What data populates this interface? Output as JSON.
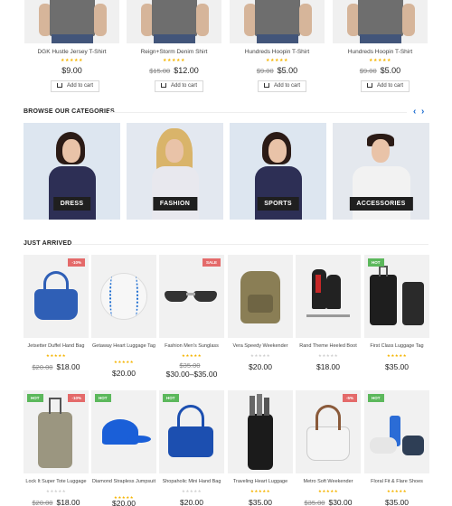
{
  "colors": {
    "accent": "#1a6bd0",
    "star": "#f5b400",
    "sale_badge": "#e46a6a",
    "hot_badge": "#5cb85c",
    "label_bg": "#1f1f1f"
  },
  "top_products": [
    {
      "name": "DGK Hustle Jersey T-Shirt",
      "old_price": "",
      "price": "$9.00",
      "stars": "★★★★★",
      "cart": "Add to cart"
    },
    {
      "name": "Reign+Storm Denim Shirt",
      "old_price": "$15.00",
      "price": "$12.00",
      "stars": "★★★★★",
      "cart": "Add to cart"
    },
    {
      "name": "Hundreds Hoopin T-Shirt",
      "old_price": "$9.00",
      "price": "$5.00",
      "stars": "★★★★★",
      "cart": "Add to cart"
    },
    {
      "name": "Hundreds Hoopin T-Shirt",
      "old_price": "$9.00",
      "price": "$5.00",
      "stars": "★★★★★",
      "cart": "Add to cart"
    }
  ],
  "categories_section": {
    "title": "BROWSE OUR CATEGORIES",
    "prev_icon": "chevron-left-icon",
    "next_icon": "chevron-right-icon",
    "items": [
      {
        "label": "DRESS"
      },
      {
        "label": "FASHION"
      },
      {
        "label": "SPORTS"
      },
      {
        "label": "ACCESSORIES"
      }
    ]
  },
  "just_arrived": {
    "title": "JUST ARRIVED",
    "row1": [
      {
        "name": "Jetsetter Duffel Hand Bag",
        "old_price": "$20.00",
        "price": "$18.00",
        "stars": "★★★★★",
        "badge": "-10%",
        "badge_type": "sale"
      },
      {
        "name": "Getaway Heart Luggage Tag",
        "old_price": "",
        "price": "$20.00",
        "stars": "★★★★★",
        "badge": "",
        "badge_type": ""
      },
      {
        "name": "Fashion Men's Sunglass",
        "old_price": "$35.00",
        "price": "$30.00–$35.00",
        "stars": "★★★★★",
        "badge": "SALE",
        "badge_type": "sale"
      },
      {
        "name": "Vera Speedy Weekender",
        "old_price": "",
        "price": "$20.00",
        "stars": "★★★★★",
        "badge": "",
        "badge_type": ""
      },
      {
        "name": "Rand Theme Heeled Boot",
        "old_price": "",
        "price": "$18.00",
        "stars": "★★★★★",
        "badge": "",
        "badge_type": ""
      },
      {
        "name": "First Class Luggage Tag",
        "old_price": "",
        "price": "$35.00",
        "stars": "★★★★★",
        "badge": "HOT",
        "badge_type": "hot"
      }
    ],
    "row2": [
      {
        "name": "Lock It Super Tote Luggage",
        "old_price": "$20.00",
        "price": "$18.00",
        "stars": "★★★★★",
        "badge": "HOT",
        "badge2": "-10%"
      },
      {
        "name": "Diamond Strapless Jumpsuit",
        "old_price": "",
        "price": "$20.00",
        "stars": "★★★★★",
        "badge": "HOT",
        "badge2": ""
      },
      {
        "name": "Shopaholic Mini Hand Bag",
        "old_price": "",
        "price": "$20.00",
        "stars": "★★★★★",
        "badge": "HOT",
        "badge2": ""
      },
      {
        "name": "Traveling Heart Luggage",
        "old_price": "",
        "price": "$35.00",
        "stars": "★★★★★",
        "badge": "",
        "badge2": ""
      },
      {
        "name": "Metro Soft Weekender",
        "old_price": "$35.00",
        "price": "$30.00",
        "stars": "★★★★★",
        "badge": "",
        "badge2": "-5%"
      },
      {
        "name": "Floral Fit & Flare Shoes",
        "old_price": "",
        "price": "$35.00",
        "stars": "★★★★★",
        "badge": "HOT",
        "badge2": ""
      }
    ]
  }
}
